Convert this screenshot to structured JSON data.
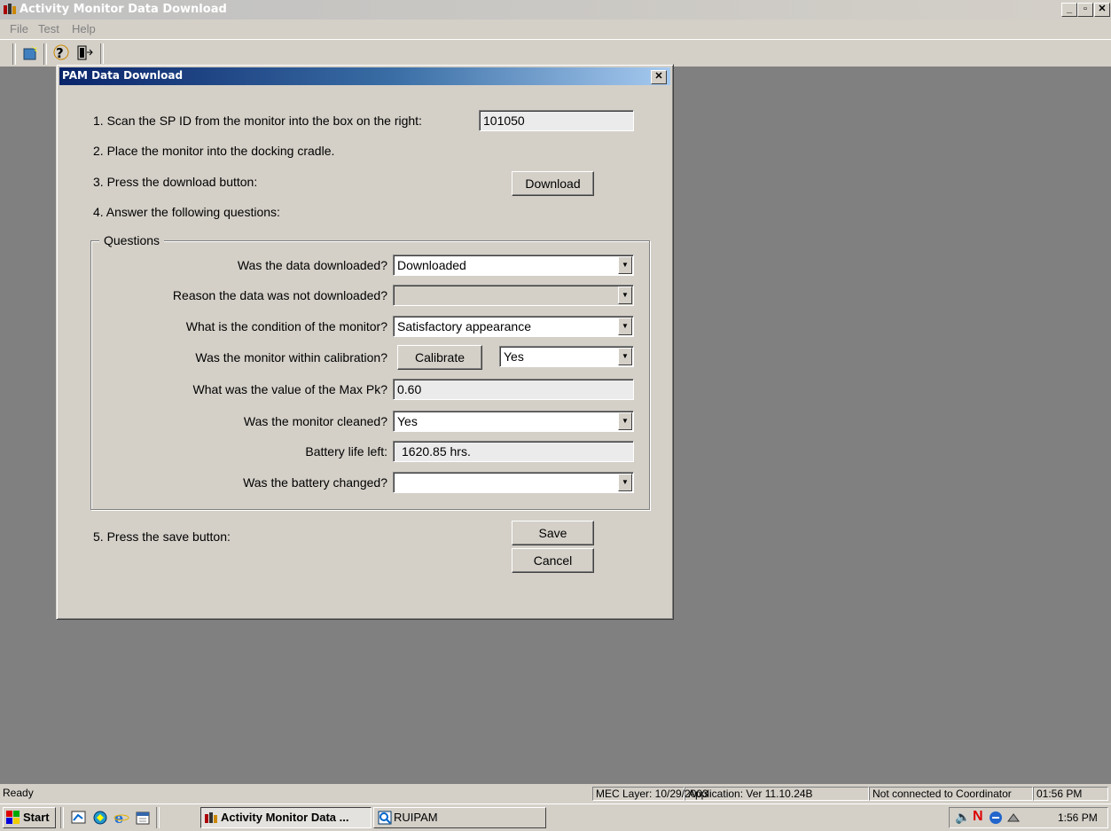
{
  "window": {
    "title": "Activity Monitor Data Download",
    "min": "_",
    "max": "▫",
    "close": "✕"
  },
  "menu": [
    "File",
    "Test",
    "Help"
  ],
  "toolbar": {
    "icons": [
      "new-icon",
      "help-icon",
      "exit-icon"
    ]
  },
  "dialog": {
    "title": "PAM Data Download",
    "close": "✕",
    "step1": "1. Scan the SP ID from the monitor into the box on the right:",
    "sp_id": "101050",
    "step2": "2. Place the monitor into the docking cradle.",
    "step3": "3. Press the download button:",
    "download_button": "Download",
    "step4": "4. Answer the following questions:",
    "questions_legend": "Questions",
    "q_downloaded": {
      "label": "Was the data downloaded?",
      "value": "Downloaded"
    },
    "q_reason": {
      "label": "Reason the data was not downloaded?",
      "value": ""
    },
    "q_condition": {
      "label": "What is the condition of the monitor?",
      "value": "Satisfactory appearance"
    },
    "q_calibration": {
      "label": "Was the monitor within calibration?",
      "button": "Calibrate",
      "value": "Yes"
    },
    "q_maxpk": {
      "label": "What was the value of the Max Pk?",
      "value": "0.60"
    },
    "q_cleaned": {
      "label": "Was the monitor cleaned?",
      "value": "Yes"
    },
    "q_battery_life": {
      "label": "Battery life left:",
      "value": "1620.85 hrs."
    },
    "q_battery_changed": {
      "label": "Was the battery changed?",
      "value": ""
    },
    "step5": "5. Press the save button:",
    "save_button": "Save",
    "cancel_button": "Cancel"
  },
  "statusbar": {
    "status": "Ready",
    "mec_layer": "MEC Layer: 10/29/2003",
    "application": "Application: Ver 11.10.24B",
    "connection": "Not connected to Coordinator",
    "time": "01:56 PM"
  },
  "taskbar": {
    "start": "Start",
    "task1": "Activity Monitor Data ...",
    "task2": "RUIPAM",
    "clock": "1:56 PM"
  }
}
